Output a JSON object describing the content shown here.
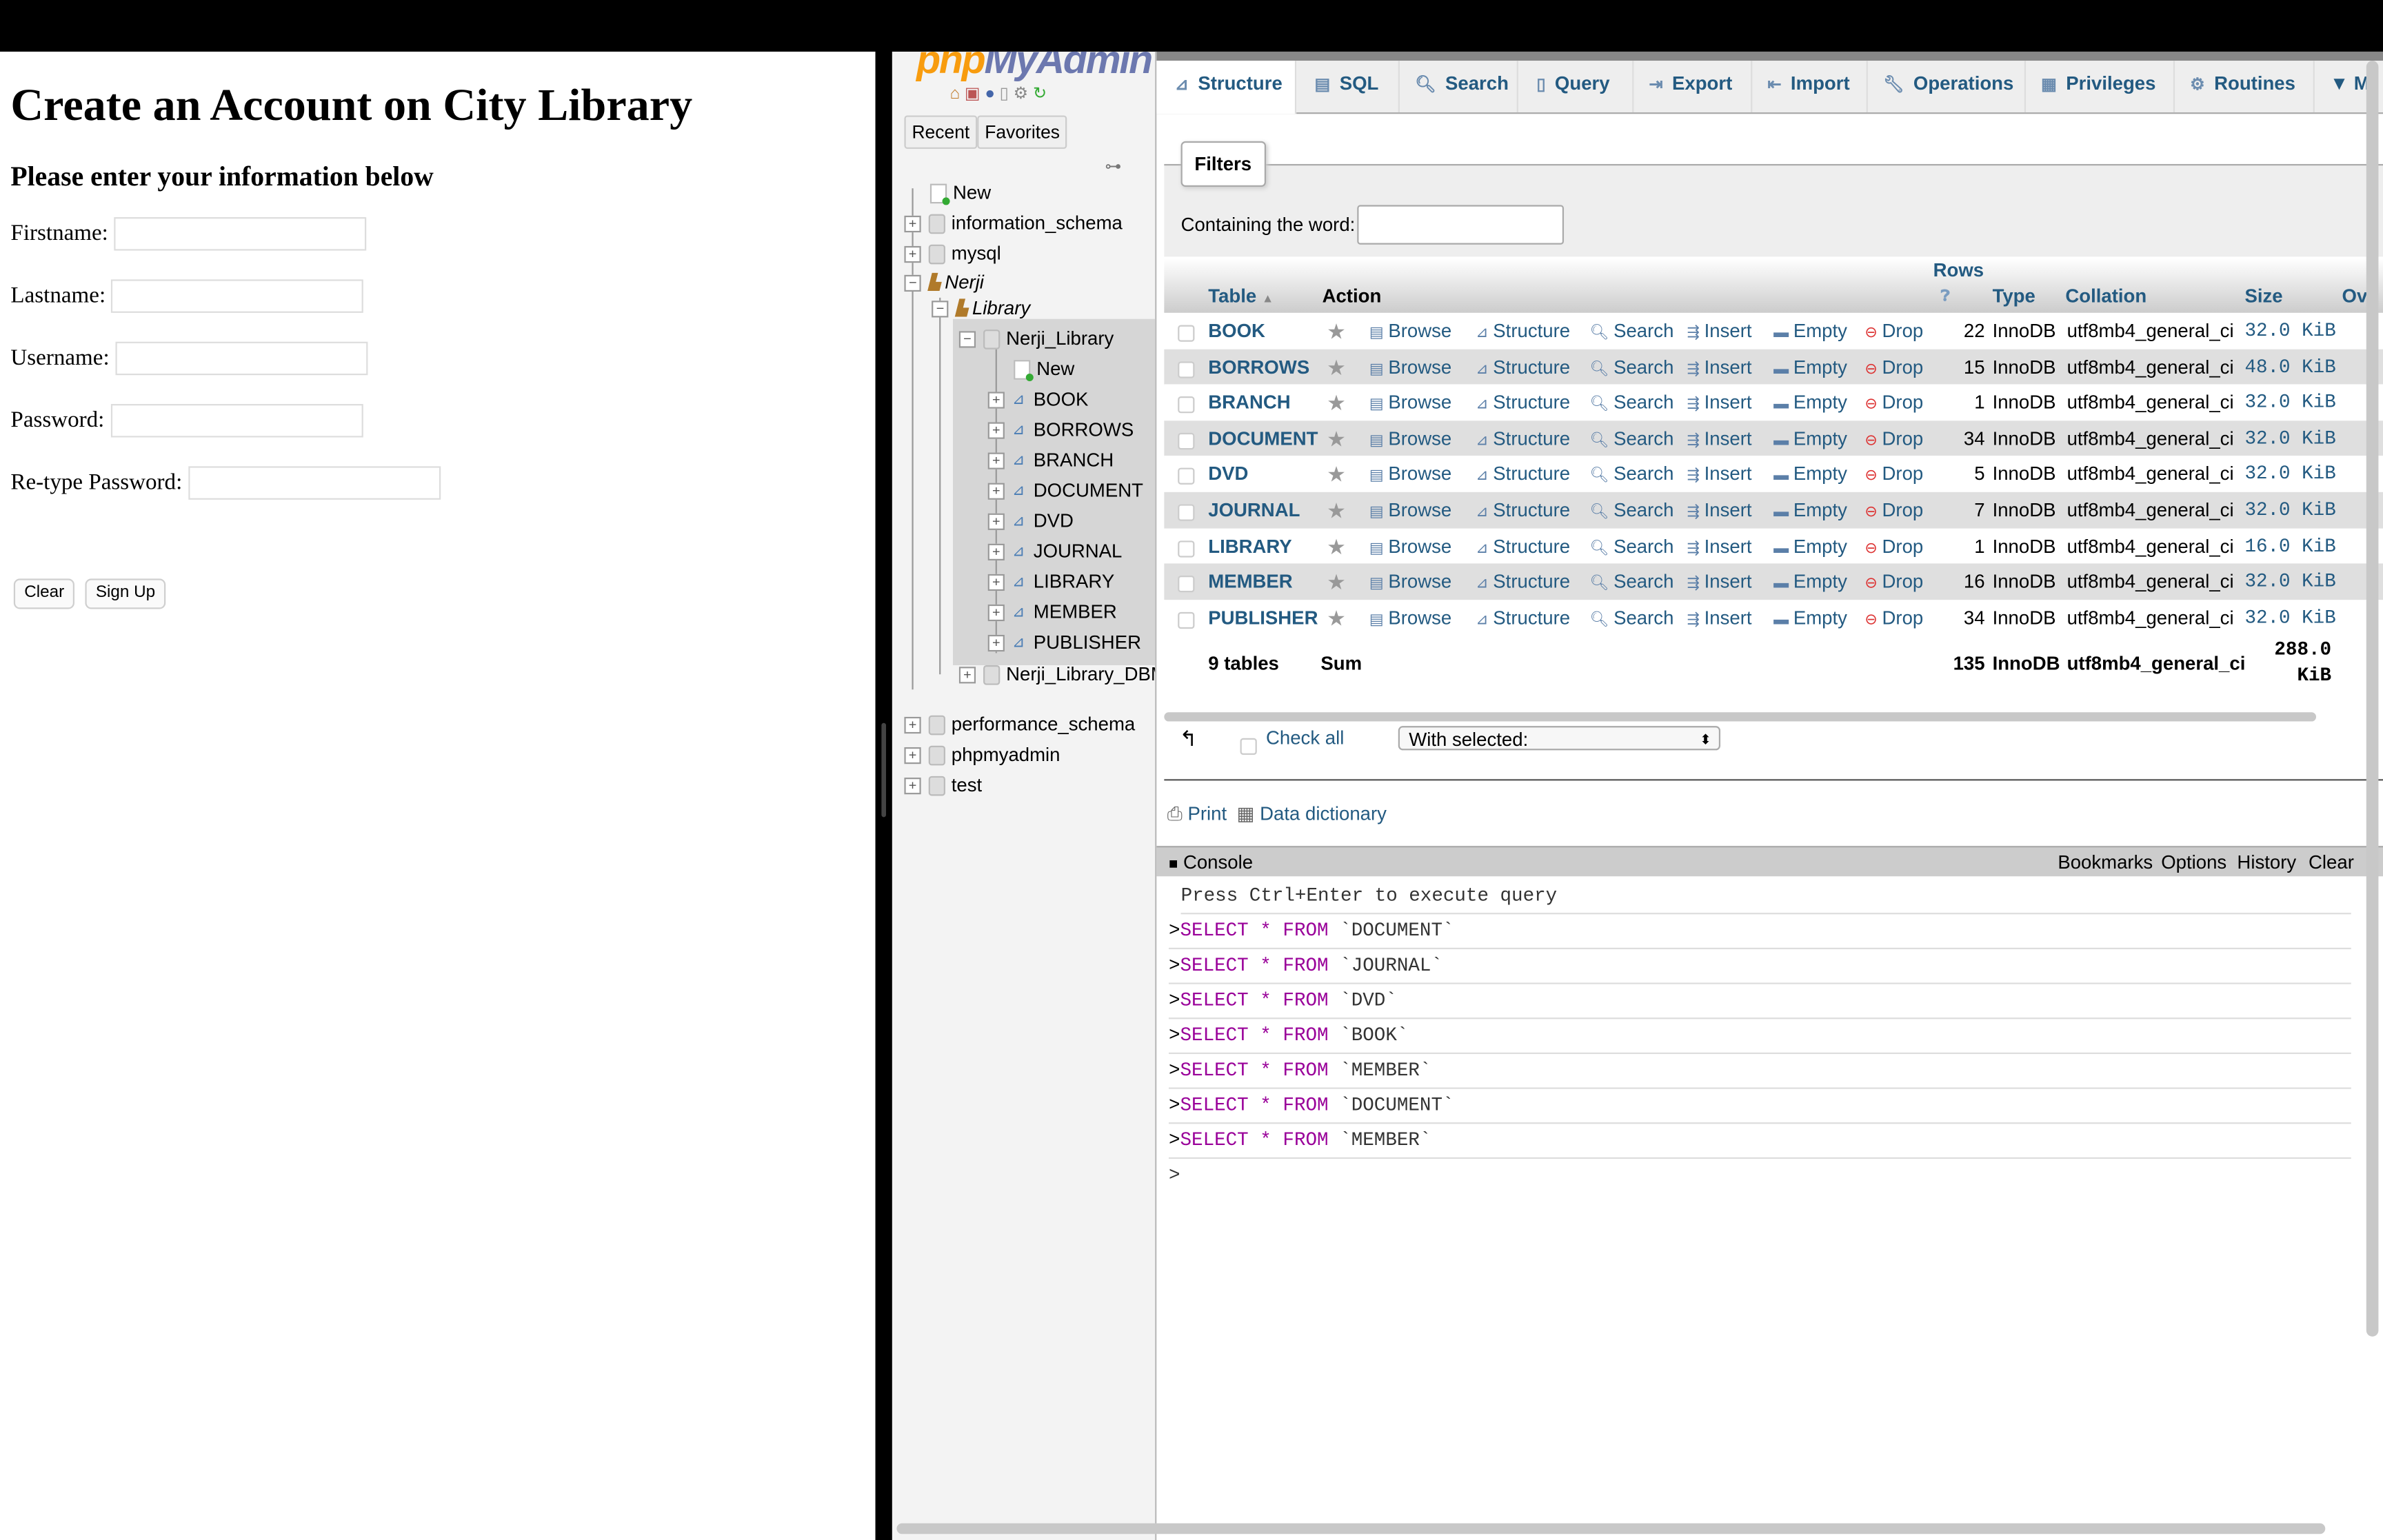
{
  "signup": {
    "title": "Create an Account on City Library",
    "subtitle": "Please enter your information below",
    "fields": [
      {
        "label": "Firstname:",
        "value": ""
      },
      {
        "label": "Lastname:",
        "value": ""
      },
      {
        "label": "Username:",
        "value": ""
      },
      {
        "label": "Password:",
        "value": ""
      },
      {
        "label": "Re-type Password:",
        "value": ""
      }
    ],
    "clear_label": "Clear",
    "signup_label": "Sign Up"
  },
  "nav": {
    "logo_php": "php",
    "logo_myadmin": "MyAdmin",
    "recent": "Recent",
    "favorites": "Favorites",
    "tree": {
      "new": "New",
      "information_schema": "information_schema",
      "mysql": "mysql",
      "nerji": "Nerji",
      "library": "Library",
      "nerji_library": "Nerji_Library",
      "db_new": "New",
      "tables": [
        "BOOK",
        "BORROWS",
        "BRANCH",
        "DOCUMENT",
        "DVD",
        "JOURNAL",
        "LIBRARY",
        "MEMBER",
        "PUBLISHER"
      ],
      "nerji_library_dbm": "Nerji_Library_DBM",
      "performance_schema": "performance_schema",
      "phpmyadmin": "phpmyadmin",
      "test": "test"
    }
  },
  "tabs": {
    "structure": "Structure",
    "sql": "SQL",
    "search": "Search",
    "query": "Query",
    "export": "Export",
    "import": "Import",
    "operations": "Operations",
    "privileges": "Privileges",
    "routines": "Routines",
    "more": "▼ M"
  },
  "filters": {
    "legend": "Filters",
    "label": "Containing the word:",
    "value": ""
  },
  "table": {
    "headers": {
      "table": "Table",
      "action": "Action",
      "rows": "Rows",
      "type": "Type",
      "collation": "Collation",
      "size": "Size",
      "overhead": "Ov"
    },
    "actions": {
      "browse": "Browse",
      "structure": "Structure",
      "search": "Search",
      "insert": "Insert",
      "empty": "Empty",
      "drop": "Drop"
    },
    "rows": [
      {
        "name": "BOOK",
        "rows": "22",
        "type": "InnoDB",
        "collation": "utf8mb4_general_ci",
        "size": "32.0 KiB"
      },
      {
        "name": "BORROWS",
        "rows": "15",
        "type": "InnoDB",
        "collation": "utf8mb4_general_ci",
        "size": "48.0 KiB"
      },
      {
        "name": "BRANCH",
        "rows": "1",
        "type": "InnoDB",
        "collation": "utf8mb4_general_ci",
        "size": "32.0 KiB"
      },
      {
        "name": "DOCUMENT",
        "rows": "34",
        "type": "InnoDB",
        "collation": "utf8mb4_general_ci",
        "size": "32.0 KiB"
      },
      {
        "name": "DVD",
        "rows": "5",
        "type": "InnoDB",
        "collation": "utf8mb4_general_ci",
        "size": "32.0 KiB"
      },
      {
        "name": "JOURNAL",
        "rows": "7",
        "type": "InnoDB",
        "collation": "utf8mb4_general_ci",
        "size": "32.0 KiB"
      },
      {
        "name": "LIBRARY",
        "rows": "1",
        "type": "InnoDB",
        "collation": "utf8mb4_general_ci",
        "size": "16.0 KiB"
      },
      {
        "name": "MEMBER",
        "rows": "16",
        "type": "InnoDB",
        "collation": "utf8mb4_general_ci",
        "size": "32.0 KiB"
      },
      {
        "name": "PUBLISHER",
        "rows": "34",
        "type": "InnoDB",
        "collation": "utf8mb4_general_ci",
        "size": "32.0 KiB"
      }
    ],
    "summary": {
      "tables": "9 tables",
      "sum": "Sum",
      "rows": "135",
      "type": "InnoDB",
      "collation": "utf8mb4_general_ci",
      "size_line1": "288.0",
      "size_line2": "KiB"
    },
    "check_all": "Check all",
    "with_selected": "With selected:"
  },
  "footer_links": {
    "print": "Print",
    "data_dictionary": "Data dictionary"
  },
  "console": {
    "title": "Console",
    "bookmarks": "Bookmarks",
    "options": "Options",
    "history": "History",
    "clear": "Clear",
    "hint": "Press Ctrl+Enter to execute query",
    "queries": [
      "DOCUMENT",
      "JOURNAL",
      "DVD",
      "BOOK",
      "MEMBER",
      "DOCUMENT",
      "MEMBER"
    ],
    "select_kw": "SELECT",
    "star": "*",
    "from_kw": "FROM",
    "prompt": ">"
  },
  "colors": {
    "link_blue": "#235a81",
    "keyword_purple": "#990099",
    "drop_red": "#dd3333"
  }
}
